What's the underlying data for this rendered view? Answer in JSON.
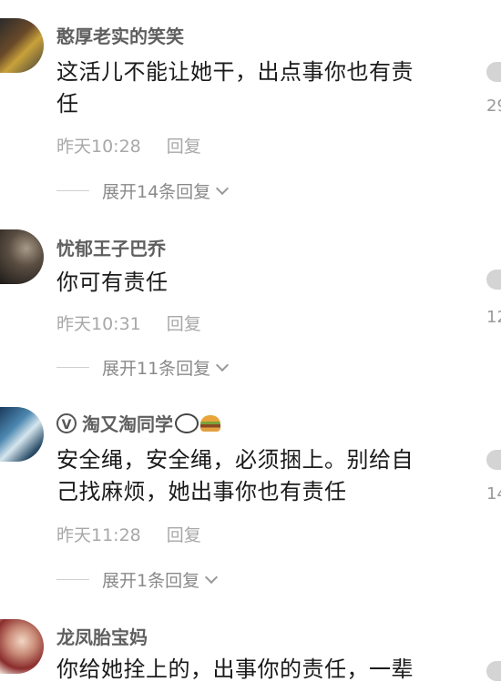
{
  "comments": [
    {
      "username": "憨厚老实的笑笑",
      "text_line1": "这活儿不能让她干，出点事你也有责",
      "text_line2": "任",
      "time": "昨天10:28",
      "reply_label": "回复",
      "expand_label": "展开14条回复",
      "like_count": "29"
    },
    {
      "username": "忧郁王子巴乔",
      "text_line1": "你可有责任",
      "time": "昨天10:31",
      "reply_label": "回复",
      "expand_label": "展开11条回复",
      "like_count": "12"
    },
    {
      "username": "淘又淘同学",
      "badge": "V",
      "text_line1": "安全绳，安全绳，必须捆上。别给自",
      "text_line2": "己找麻烦，她出事你也有责任",
      "time": "昨天11:28",
      "reply_label": "回复",
      "expand_label": "展开1条回复",
      "like_count": "14"
    },
    {
      "username": "龙凤胎宝妈",
      "text_line1": "你给她拴上的，出事你的责任，一辈"
    }
  ]
}
